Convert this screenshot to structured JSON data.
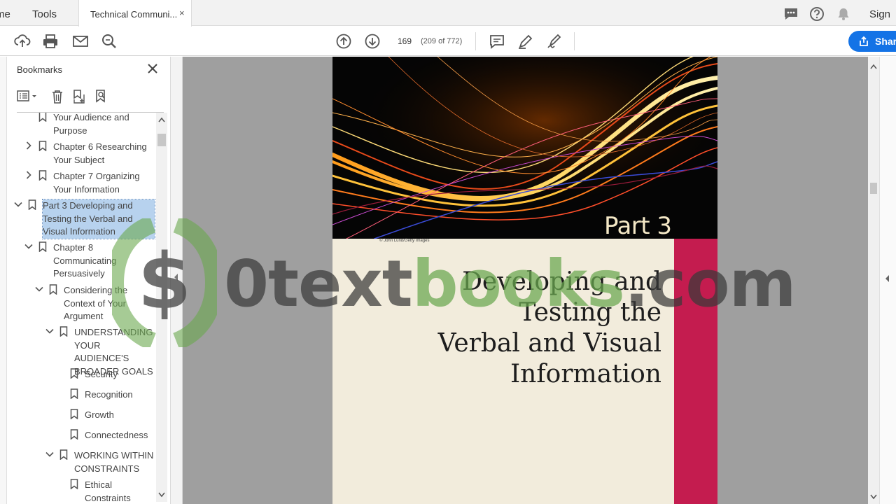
{
  "tabs": {
    "home": "me",
    "tools": "Tools",
    "document": "Technical Communi...",
    "close": "×"
  },
  "header": {
    "signin": "Sign",
    "icons": [
      "chat-icon",
      "help-icon",
      "bell-icon"
    ]
  },
  "toolbar": {
    "page_number": "169",
    "page_count": "(209 of 772)",
    "share_label": "Shar",
    "icons": [
      "upload-icon",
      "print-icon",
      "email-icon",
      "zoom-search-icon",
      "prev-page-icon",
      "next-page-icon",
      "comment-icon",
      "highlight-pen-icon",
      "sign-icon"
    ]
  },
  "bookmarks": {
    "title": "Bookmarks",
    "items": [
      {
        "label": "Your Audience and\nPurpose",
        "level": 2,
        "expander": "none",
        "selected": false
      },
      {
        "label": "Chapter 6 Researching\nYour Subject",
        "level": 2,
        "expander": "collapsed",
        "selected": false
      },
      {
        "label": "Chapter 7 Organizing\nYour Information",
        "level": 2,
        "expander": "collapsed",
        "selected": false
      },
      {
        "label": "Part 3 Developing and\nTesting the Verbal and\nVisual Information",
        "level": 1,
        "expander": "expanded",
        "selected": true
      },
      {
        "label": "Chapter 8\nCommunicating\nPersuasively",
        "level": 2,
        "expander": "expanded",
        "selected": false
      },
      {
        "label": "Considering the\nContext of Your\nArgument",
        "level": 3,
        "expander": "expanded",
        "selected": false
      },
      {
        "label": "UNDERSTANDING\nYOUR AUDIENCE'S\nBROADER GOALS",
        "level": 4,
        "expander": "expanded",
        "selected": false
      },
      {
        "label": "Security",
        "level": 5,
        "expander": "none",
        "selected": false
      },
      {
        "label": "Recognition",
        "level": 5,
        "expander": "none",
        "selected": false
      },
      {
        "label": "Growth",
        "level": 5,
        "expander": "none",
        "selected": false
      },
      {
        "label": "Connectedness",
        "level": 5,
        "expander": "none",
        "selected": false
      },
      {
        "label": "WORKING WITHIN\nCONSTRAINTS",
        "level": 4,
        "expander": "expanded",
        "selected": false
      },
      {
        "label": "Ethical\nConstraints",
        "level": 5,
        "expander": "none",
        "selected": false
      }
    ]
  },
  "document": {
    "part_label": "Part 3",
    "credit": "© John Lund/Getty Images",
    "part_title": "Developing and\nTesting the\nVerbal and Visual\nInformation"
  },
  "watermark": {
    "dollar": "$",
    "part1": "0text",
    "part2": "books",
    "part3": ".com"
  },
  "colors": {
    "accent": "#1473e6",
    "selection": "#b7d2ee",
    "crimson": "#c41c4f",
    "page": "#f2ecdc",
    "watermark_green": "#6aa84f"
  }
}
